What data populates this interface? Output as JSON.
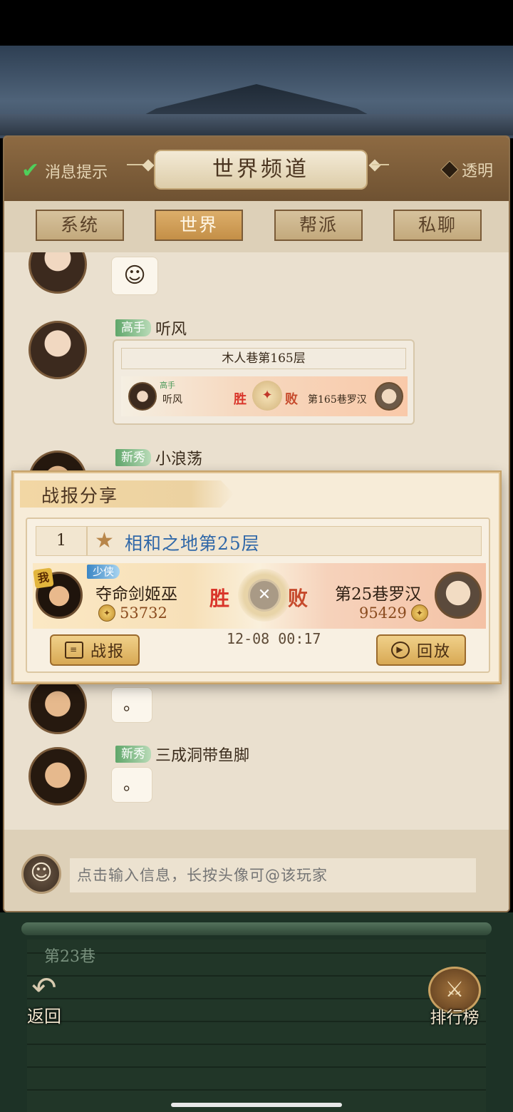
{
  "background": {
    "wall_label": "第23巷",
    "back_label": "返回",
    "ranking_label": "排行榜"
  },
  "panel": {
    "title": "世界频道",
    "notify_label": "消息提示",
    "transparent_label": "透明",
    "tabs": [
      {
        "label": "系统",
        "active": false
      },
      {
        "label": "世界",
        "active": true
      },
      {
        "label": "帮派",
        "active": false
      },
      {
        "label": "私聊",
        "active": false
      }
    ]
  },
  "messages": [
    {
      "type": "emoji",
      "content_icon": "laughing-face-icon"
    },
    {
      "type": "battle",
      "rank": "高手",
      "name": "听风",
      "report": {
        "level": "木人巷第165层",
        "player": {
          "rank": "高手",
          "name": "听风"
        },
        "result_left": "胜",
        "result_right": "败",
        "opponent": "第165巷罗汉"
      }
    },
    {
      "type": "text",
      "rank": "新秀",
      "name": "小浪荡"
    },
    {
      "type": "text",
      "text": "。"
    },
    {
      "type": "text",
      "rank": "新秀",
      "name": "三成洞带鱼脚",
      "text": "。"
    }
  ],
  "input": {
    "placeholder": "点击输入信息，长按头像可@该玩家"
  },
  "popup": {
    "title": "战报分享",
    "index": "1",
    "level_name": "相和之地第25层",
    "me_tag": "我",
    "player": {
      "rank": "少侠",
      "name": "夺命剑姬巫",
      "power": "53732"
    },
    "opponent": {
      "name": "第25巷罗汉",
      "power": "95429"
    },
    "result_left": "胜",
    "result_right": "败",
    "timestamp": "12-08 00:17",
    "report_button": "战报",
    "replay_button": "回放",
    "colors": {
      "win": "#d9352a",
      "lose": "#c64a2c",
      "level_name": "#2f67a8"
    }
  }
}
